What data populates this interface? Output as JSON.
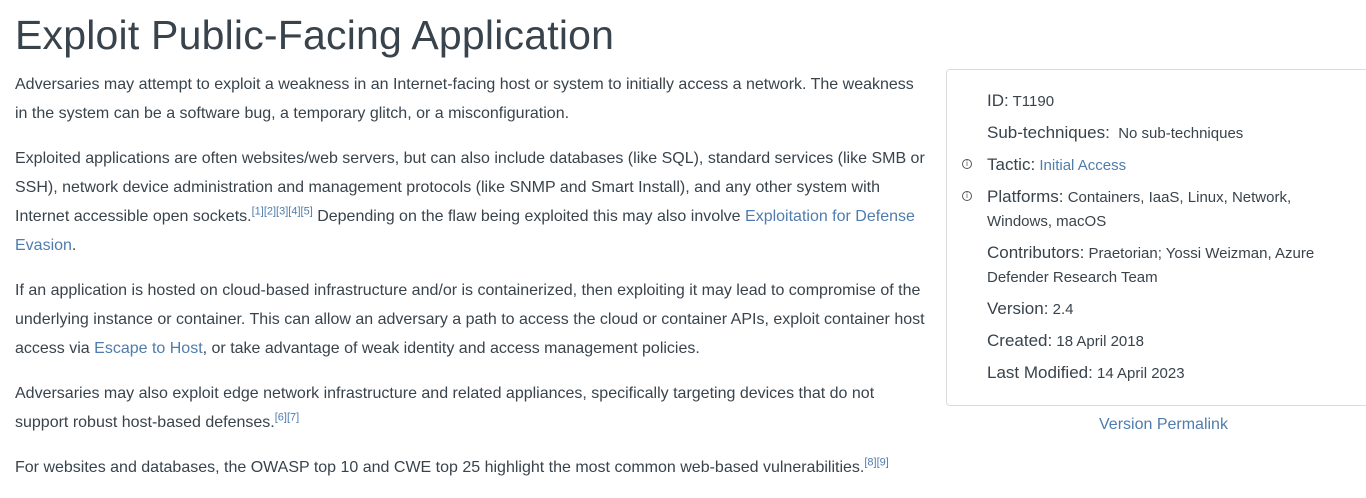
{
  "page": {
    "title": "Exploit Public-Facing Application"
  },
  "description": {
    "p1": "Adversaries may attempt to exploit a weakness in an Internet-facing host or system to initially access a network. The weakness in the system can be a software bug, a temporary glitch, or a misconfiguration.",
    "p2_text": "Exploited applications are often websites/web servers, but can also include databases (like SQL), standard services (like SMB or SSH), network device administration and management protocols (like SNMP and Smart Install), and any other system with Internet accessible open sockets.",
    "p2_refs": [
      "[1]",
      "[2]",
      "[3]",
      "[4]",
      "[5]"
    ],
    "p2_text2": " Depending on the flaw being exploited this may also involve ",
    "p2_link": "Exploitation for Defense Evasion",
    "p2_end": ".",
    "p3_text": "If an application is hosted on cloud-based infrastructure and/or is containerized, then exploiting it may lead to compromise of the underlying instance or container. This can allow an adversary a path to access the cloud or container APIs, exploit container host access via ",
    "p3_link": "Escape to Host",
    "p3_end": ", or take advantage of weak identity and access management policies.",
    "p4_text": "Adversaries may also exploit edge network infrastructure and related appliances, specifically targeting devices that do not support robust host-based defenses.",
    "p4_refs": [
      "[6]",
      "[7]"
    ],
    "p5_text": "For websites and databases, the OWASP top 10 and CWE top 25 highlight the most common web-based vulnerabilities.",
    "p5_refs": [
      "[8]",
      "[9]"
    ]
  },
  "card": {
    "id_label": "ID:",
    "id_value": "T1190",
    "subtech_label": "Sub-techniques:",
    "subtech_value": "No sub-techniques",
    "tactic_label": "Tactic:",
    "tactic_value": "Initial Access",
    "platforms_label": "Platforms:",
    "platforms_value": "Containers, IaaS, Linux, Network, Windows, macOS",
    "contributors_label": "Contributors:",
    "contributors_value": "Praetorian; Yossi Weizman, Azure Defender Research Team",
    "version_label": "Version:",
    "version_value": "2.4",
    "created_label": "Created:",
    "created_value": "18 April 2018",
    "modified_label": "Last Modified:",
    "modified_value": "14 April 2023",
    "info_icon_glyph": "i"
  },
  "permalink": "Version Permalink"
}
